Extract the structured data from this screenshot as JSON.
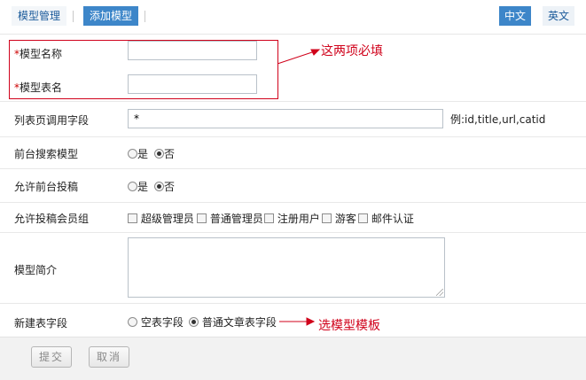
{
  "tabs": {
    "manage": "模型管理",
    "add": "添加模型",
    "lang_cn": "中文",
    "lang_en": "英文"
  },
  "form": {
    "model_name": {
      "label": "模型名称",
      "required_mark": "*",
      "value": ""
    },
    "table_name": {
      "label": "模型表名",
      "required_mark": "*",
      "value": ""
    },
    "list_fields": {
      "label": "列表页调用字段",
      "value": "*",
      "hint": "例:id,title,url,catid"
    },
    "front_search": {
      "label": "前台搜索模型",
      "options": [
        "是",
        "否"
      ],
      "selected": "否"
    },
    "allow_submit": {
      "label": "允许前台投稿",
      "options": [
        "是",
        "否"
      ],
      "selected": "否"
    },
    "submit_groups": {
      "label": "允许投稿会员组",
      "options": [
        "超级管理员",
        "普通管理员",
        "注册用户",
        "游客",
        "邮件认证"
      ]
    },
    "description": {
      "label": "模型简介",
      "value": ""
    },
    "new_table_fields": {
      "label": "新建表字段",
      "options": [
        "空表字段",
        "普通文章表字段"
      ],
      "selected": "普通文章表字段"
    }
  },
  "annotations": {
    "required_note": "这两项必填",
    "template_note": "选模型模板",
    "color": "#d0021b"
  },
  "buttons": {
    "submit": "提交",
    "cancel": "取消"
  }
}
